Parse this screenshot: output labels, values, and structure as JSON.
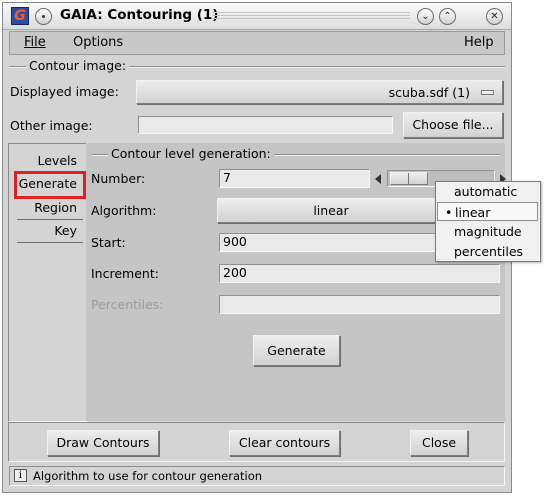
{
  "window": {
    "title": "GAIA: Contouring (1)",
    "app_icon_letter": "G",
    "controls": {
      "minimize": "⌄",
      "maximize": "⌃",
      "close": "✕"
    }
  },
  "menubar": {
    "file": "File",
    "options": "Options",
    "help": "Help"
  },
  "contour_image": {
    "group_label": "Contour image:",
    "displayed_label": "Displayed image:",
    "displayed_value": "scuba.sdf (1)",
    "other_label": "Other image:",
    "other_value": "",
    "choose_file": "Choose file..."
  },
  "tabs": [
    {
      "label": "Levels"
    },
    {
      "label": "Generate"
    },
    {
      "label": "Region"
    },
    {
      "label": "Key"
    }
  ],
  "generation": {
    "group_label": "Contour level generation:",
    "number_label": "Number:",
    "number_value": "7",
    "algorithm_label": "Algorithm:",
    "algorithm_value": "linear",
    "start_label": "Start:",
    "start_value": "900",
    "increment_label": "Increment:",
    "increment_value": "200",
    "percentiles_label": "Percentiles:",
    "percentiles_value": "",
    "generate_button": "Generate"
  },
  "algorithm_menu": {
    "options": [
      "automatic",
      "linear",
      "magnitude",
      "percentiles"
    ],
    "selected": "linear",
    "bullet": "•"
  },
  "buttons": {
    "draw": "Draw Contours",
    "clear": "Clear contours",
    "close": "Close"
  },
  "status": {
    "icon": "i",
    "text": "Algorithm to use for contour generation"
  }
}
